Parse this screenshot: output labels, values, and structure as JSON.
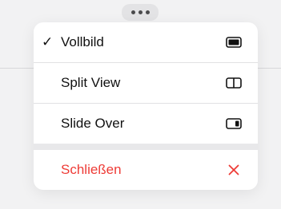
{
  "handle": {
    "icon": "ellipsis-icon"
  },
  "menu": {
    "items": [
      {
        "label": "Vollbild",
        "checked": true,
        "check_glyph": "✓",
        "icon": "fullscreen-icon"
      },
      {
        "label": "Split View",
        "checked": false,
        "icon": "split-view-icon"
      },
      {
        "label": "Slide Over",
        "checked": false,
        "icon": "slide-over-icon"
      }
    ],
    "close": {
      "label": "Schließen",
      "icon": "close-x-icon",
      "color": "#ee3b36"
    }
  }
}
